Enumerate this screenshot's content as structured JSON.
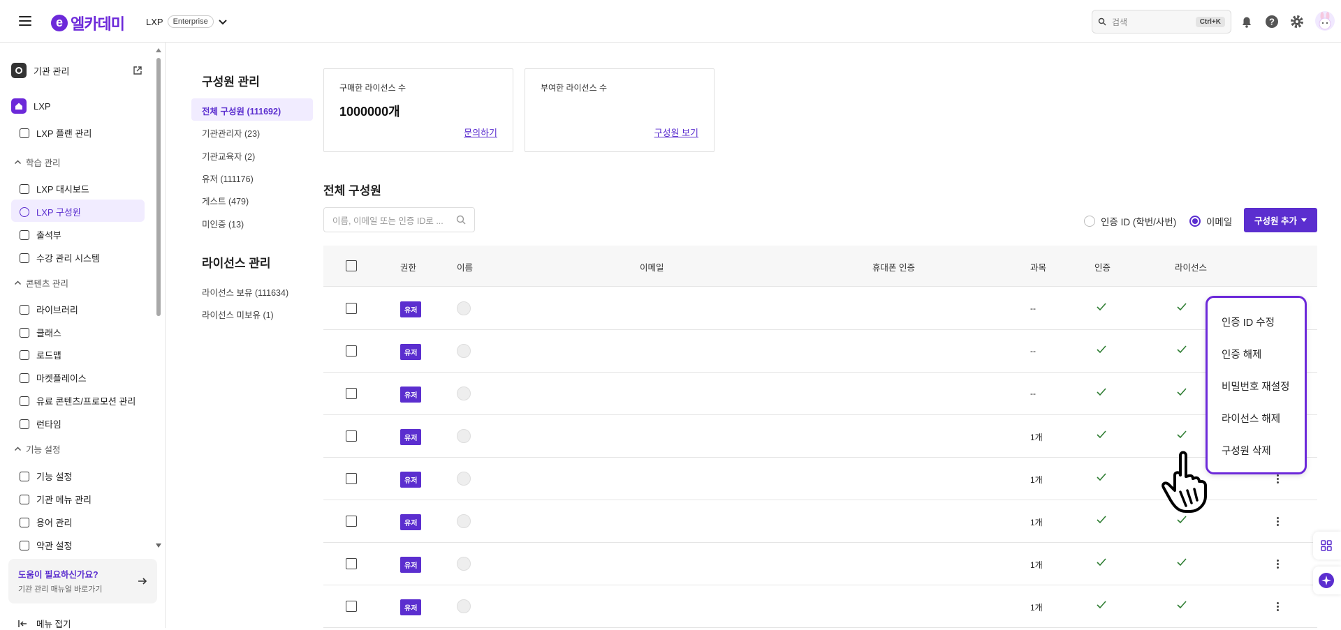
{
  "header": {
    "logo_letter": "e",
    "logo_text": "엘카데미",
    "product": "LXP",
    "edition": "Enterprise",
    "search_placeholder": "검색",
    "search_shortcut": "Ctrl+K"
  },
  "sidebar": {
    "org_admin": "기관 관리",
    "lxp": "LXP",
    "lxp_plan": "LXP 플랜 관리",
    "section_learning": "학습 관리",
    "dashboard": "LXP 대시보드",
    "members": "LXP 구성원",
    "attendance": "출석부",
    "enrollment": "수강 관리 시스템",
    "section_content": "콘텐츠 관리",
    "library": "라이브러리",
    "class": "클래스",
    "roadmap": "로드맵",
    "marketplace": "마켓플레이스",
    "paid": "유료 콘텐츠/프로모션 관리",
    "runtime": "런타임",
    "section_features": "기능 설정",
    "feature_settings": "기능 설정",
    "org_menu": "기관 메뉴 관리",
    "terms_mgmt": "용어 관리",
    "policy": "약관 설정",
    "help_title": "도움이 필요하신가요?",
    "help_sub": "기관 관리 매뉴얼 바로가기",
    "collapse": "메뉴 접기"
  },
  "subnav": {
    "members_title": "구성원 관리",
    "all": "전체 구성원 (111692)",
    "org_admin": "기관관리자 (23)",
    "org_teacher": "기관교육자 (2)",
    "user": "유저 (111176)",
    "guest": "게스트 (479)",
    "unverified": "미인증 (13)",
    "license_title": "라이선스 관리",
    "license_have": "라이선스 보유 (111634)",
    "license_none": "라이선스 미보유 (1)"
  },
  "cards": {
    "purchased_label": "구매한 라이선스 수",
    "purchased_value": "1000000개",
    "purchased_link": "문의하기",
    "granted_label": "부여한 라이선스 수",
    "granted_link": "구성원 보기"
  },
  "list": {
    "title": "전체 구성원",
    "search_placeholder": "이름, 이메일 또는 인증 ID로 ...",
    "radio_id": "인증 ID (학번/사번)",
    "radio_email": "이메일",
    "add_button": "구성원 추가"
  },
  "table": {
    "headers": {
      "role": "권한",
      "name": "이름",
      "email": "이메일",
      "phone": "휴대폰 인증",
      "course": "과목",
      "auth": "인증",
      "license": "라이선스"
    },
    "rows": [
      {
        "role": "유저",
        "course": "--"
      },
      {
        "role": "유저",
        "course": "--"
      },
      {
        "role": "유저",
        "course": "--"
      },
      {
        "role": "유저",
        "course": "1개"
      },
      {
        "role": "유저",
        "course": "1개"
      },
      {
        "role": "유저",
        "course": "1개"
      },
      {
        "role": "유저",
        "course": "1개"
      },
      {
        "role": "유저",
        "course": "1개"
      }
    ]
  },
  "context_menu": {
    "edit_id": "인증 ID 수정",
    "unverify": "인증 해제",
    "reset_pw": "비밀번호 재설정",
    "revoke_license": "라이선스 해제",
    "delete_member": "구성원 삭제"
  },
  "colors": {
    "brand": "#6c29d9",
    "accent": "#5b2ecf",
    "check": "#2e7d32"
  }
}
